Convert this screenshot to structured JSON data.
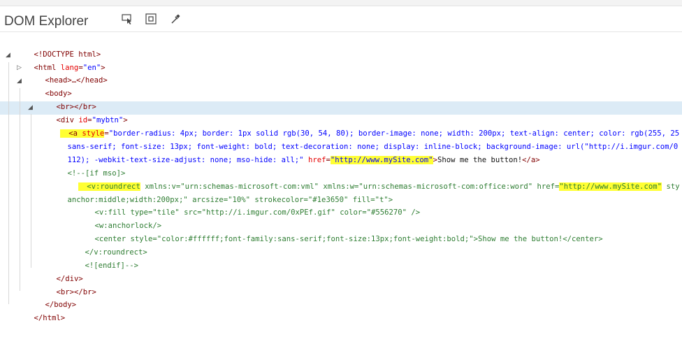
{
  "header": {
    "title": "DOM Explorer",
    "tools": [
      {
        "name": "select-element-icon",
        "label": "Select element"
      },
      {
        "name": "highlight-box-icon",
        "label": "Display web page highlights"
      },
      {
        "name": "eyedropper-icon",
        "label": "Color picker"
      }
    ]
  },
  "lines": {
    "l1_doctype": "<!DOCTYPE html>",
    "l2_html_open": "<html ",
    "l2_attr_lang": "lang",
    "l2_eq": "=",
    "l2_val": "\"en\"",
    "l2_close": ">",
    "l3_head": "<head>…</head>",
    "l4_body": "<body>",
    "l5_br": "<br></br>",
    "l6_div_open": "<div ",
    "l6_attr_id": "id",
    "l6_eq": "=",
    "l6_val": "\"mybtn\"",
    "l6_close": ">",
    "l7_a_open": "<a ",
    "l7_attr_style": "style",
    "l7_eq": "=",
    "l7_style_val": "\"border-radius: 4px; border: 1px solid rgb(30, 54, 80); border-image: none; width: 200px; text-align: center; color: rgb(255, 25",
    "l8_text": "sans-serif; font-size: 13px; font-weight: bold; text-decoration: none; display: inline-block; background-image: url(\"http://i.imgur.com/0",
    "l9_text": "112); -webkit-text-size-adjust: none; mso-hide: all;\"",
    "l9_attr_href": "href",
    "l9_eq": "=",
    "l9_href_val": "\"http://www.mySite.com\"",
    "l9_close_tag": ">",
    "l9_link_text": "Show me the button!",
    "l9_end": "</a>",
    "l10_comment": "<!--[if mso]>",
    "l11_tag": "<v:roundrect",
    "l11_attrs": " xmlns:v=\"urn:schemas-microsoft-com:vml\" xmlns:w=\"urn:schemas-microsoft-com:office:word\" href=",
    "l11_href_val": "\"http://www.mySite.com\"",
    "l11_tail": " sty",
    "l12_text": "anchor:middle;width:200px;\" arcsize=\"10%\" strokecolor=\"#1e3650\" fill=\"t\">",
    "l13_text": "<v:fill type=\"tile\" src=\"http://i.imgur.com/0xPEf.gif\" color=\"#556270\" />",
    "l14_text": "<w:anchorlock/>",
    "l15_text": "<center style=\"color:#ffffff;font-family:sans-serif;font-size:13px;font-weight:bold;\">Show me the button!</center>",
    "l16_text": "</v:roundrect>",
    "l17_text": "<![endif]-->",
    "l18_div_close": "</div>",
    "l19_br": "<br></br>",
    "l20_body_close": "</body>",
    "l21_html_close": "</html>"
  },
  "twisties": {
    "expanded": "◢",
    "collapsed": "▷"
  },
  "colors": {
    "tag": "#800000",
    "attr_name": "#e50000",
    "attr_value": "#0000ff",
    "comment": "#2e7d32",
    "selection_bg": "#dcebf6",
    "highlight": "#ffff33"
  }
}
